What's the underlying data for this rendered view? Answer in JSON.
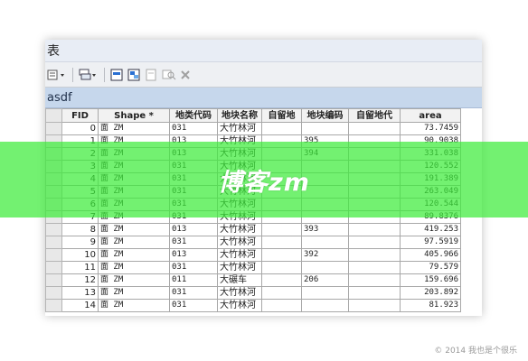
{
  "window": {
    "title": "表"
  },
  "tab": {
    "label": "asdf"
  },
  "toolbar": {
    "buttons": [
      "table-options",
      "related-tables",
      "select-by-attributes",
      "switch-selection",
      "clear-selection",
      "zoom-to-selected",
      "delete-selected"
    ]
  },
  "table": {
    "columns": [
      "FID",
      "Shape *",
      "地类代码",
      "地块名称",
      "自留地",
      "地块编码",
      "自留地代",
      "area"
    ],
    "rows": [
      {
        "fid": "0",
        "shape": "面 ZM",
        "code": "031",
        "name": "大竹林河",
        "reserved": "",
        "block_code": "",
        "reserved_code": "",
        "area": "73.7459"
      },
      {
        "fid": "1",
        "shape": "面 ZM",
        "code": "013",
        "name": "大竹林河",
        "reserved": "",
        "block_code": "395",
        "reserved_code": "",
        "area": "90.9038"
      },
      {
        "fid": "2",
        "shape": "面 ZM",
        "code": "013",
        "name": "大竹林河",
        "reserved": "",
        "block_code": "394",
        "reserved_code": "",
        "area": "331.038"
      },
      {
        "fid": "3",
        "shape": "面 ZM",
        "code": "031",
        "name": "大竹林河",
        "reserved": "",
        "block_code": "",
        "reserved_code": "",
        "area": "120.552"
      },
      {
        "fid": "4",
        "shape": "面 ZM",
        "code": "031",
        "name": "大竹林河",
        "reserved": "",
        "block_code": "",
        "reserved_code": "",
        "area": "191.389"
      },
      {
        "fid": "5",
        "shape": "面 ZM",
        "code": "031",
        "name": "大竹林河",
        "reserved": "",
        "block_code": "",
        "reserved_code": "",
        "area": "263.049"
      },
      {
        "fid": "6",
        "shape": "面 ZM",
        "code": "031",
        "name": "大竹林河",
        "reserved": "",
        "block_code": "",
        "reserved_code": "",
        "area": "120.544"
      },
      {
        "fid": "7",
        "shape": "面 ZM",
        "code": "031",
        "name": "大竹林河",
        "reserved": "",
        "block_code": "",
        "reserved_code": "",
        "area": "89.8376"
      },
      {
        "fid": "8",
        "shape": "面 ZM",
        "code": "013",
        "name": "大竹林河",
        "reserved": "",
        "block_code": "393",
        "reserved_code": "",
        "area": "419.253"
      },
      {
        "fid": "9",
        "shape": "面 ZM",
        "code": "031",
        "name": "大竹林河",
        "reserved": "",
        "block_code": "",
        "reserved_code": "",
        "area": "97.5919"
      },
      {
        "fid": "10",
        "shape": "面 ZM",
        "code": "013",
        "name": "大竹林河",
        "reserved": "",
        "block_code": "392",
        "reserved_code": "",
        "area": "405.966"
      },
      {
        "fid": "11",
        "shape": "面 ZM",
        "code": "031",
        "name": "大竹林河",
        "reserved": "",
        "block_code": "",
        "reserved_code": "",
        "area": "79.579"
      },
      {
        "fid": "12",
        "shape": "面 ZM",
        "code": "011",
        "name": "大碾车",
        "reserved": "",
        "block_code": "206",
        "reserved_code": "",
        "area": "159.696"
      },
      {
        "fid": "13",
        "shape": "面 ZM",
        "code": "031",
        "name": "大竹林河",
        "reserved": "",
        "block_code": "",
        "reserved_code": "",
        "area": "203.892"
      },
      {
        "fid": "14",
        "shape": "面 ZM",
        "code": "031",
        "name": "大竹林河",
        "reserved": "",
        "block_code": "",
        "reserved_code": "",
        "area": "81.923"
      }
    ]
  },
  "watermark": {
    "text": "博客zm",
    "credit": "© 2014 我也是个很乐"
  },
  "colors": {
    "band": "#3dec3a",
    "tab": "#c6d7ec",
    "titlebar": "#e8edf5"
  }
}
